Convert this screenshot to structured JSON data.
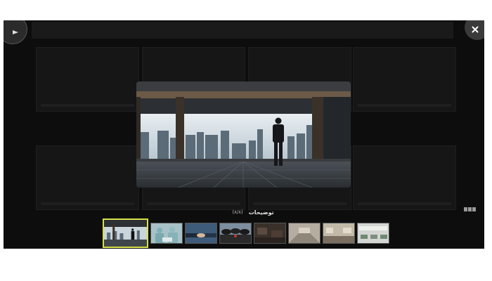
{
  "viewer": {
    "caption_title": "توضیحات",
    "counter": "(۸/۸)",
    "active_index": 0,
    "icons": {
      "play": "play-icon",
      "close": "close-icon",
      "grid": "grid-view-icon"
    },
    "thumbnails": [
      {
        "subject": "businessman-city-view"
      },
      {
        "subject": "surgeons-operating-room"
      },
      {
        "subject": "handshake"
      },
      {
        "subject": "umbrellas-group"
      },
      {
        "subject": "dark-room"
      },
      {
        "subject": "hallway"
      },
      {
        "subject": "office-room"
      },
      {
        "subject": "open-office"
      }
    ]
  }
}
